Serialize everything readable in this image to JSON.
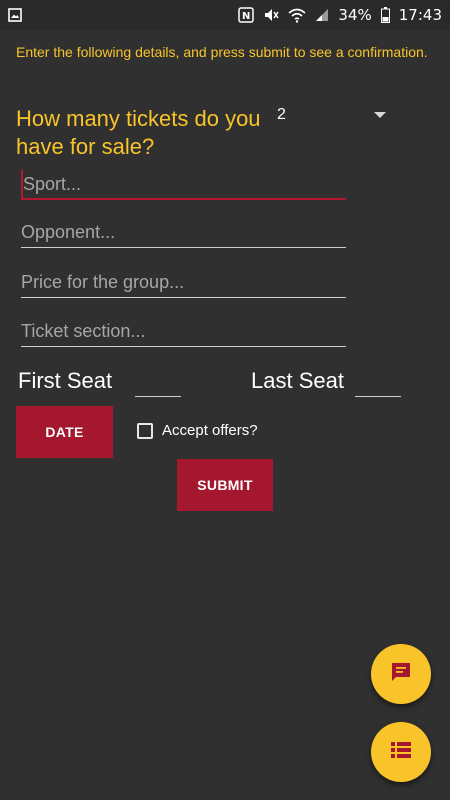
{
  "status_bar": {
    "battery": "34%",
    "time": "17:43",
    "icons": [
      "image-icon",
      "nfc-icon",
      "mute-icon",
      "wifi-icon",
      "signal-icon",
      "battery-icon"
    ]
  },
  "form": {
    "intro": "Enter the following details, and press submit to see a confirmation.",
    "question": "How many tickets do you have for sale?",
    "ticket_count": "2",
    "fields": {
      "sport_placeholder": "Sport...",
      "opponent_placeholder": "Opponent...",
      "price_placeholder": "Price for the group...",
      "section_placeholder": "Ticket section..."
    },
    "first_seat_label": "First Seat",
    "last_seat_label": "Last Seat",
    "date_button": "DATE",
    "accept_offers_label": "Accept offers?",
    "submit_button": "SUBMIT"
  },
  "fabs": {
    "chat_icon": "chat-icon",
    "list_icon": "list-icon"
  },
  "colors": {
    "background": "#303030",
    "accent_yellow": "#f9c42a",
    "button_red": "#a5172e"
  }
}
